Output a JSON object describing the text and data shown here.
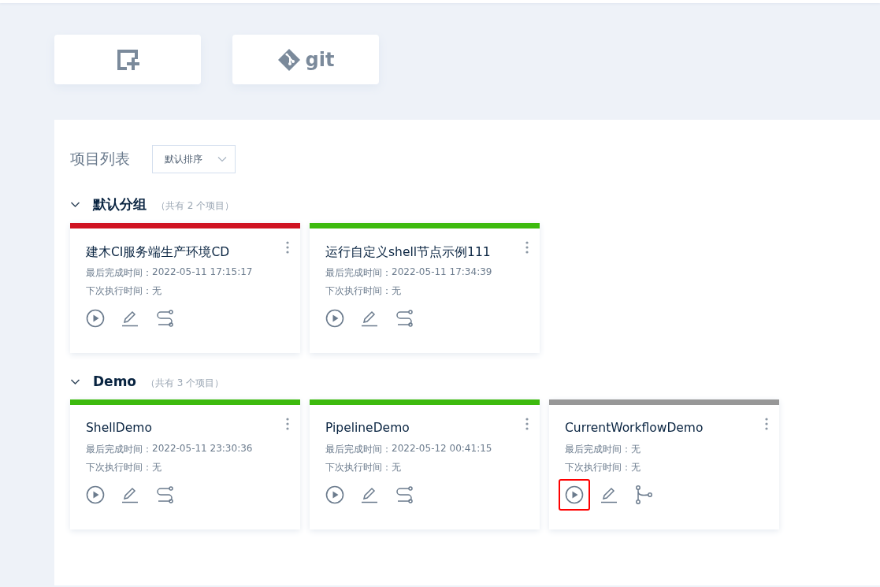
{
  "toolbar": {
    "git_label": "git"
  },
  "panel": {
    "title": "项目列表",
    "sort": {
      "value": "默认排序"
    }
  },
  "groups": [
    {
      "name": "默认分组",
      "count": "（共有 2 个项目）",
      "expanded": true,
      "cards": [
        {
          "kind": "pipeline",
          "color": "#cf1322",
          "title": "建木CI服务端生产环境CD",
          "last_label": "最后完成时间：",
          "last": "2022-05-11 17:15:17",
          "next_label": "下次执行时间：",
          "next": "无",
          "highlighted": false
        },
        {
          "kind": "pipeline",
          "color": "#3dba0e",
          "title": "运行自定义shell节点示例111",
          "last_label": "最后完成时间：",
          "last": "2022-05-11 17:34:39",
          "next_label": "下次执行时间：",
          "next": "无",
          "highlighted": false
        }
      ]
    },
    {
      "name": "Demo",
      "count": "（共有 3 个项目）",
      "expanded": true,
      "cards": [
        {
          "kind": "pipeline",
          "color": "#3dba0e",
          "title": "ShellDemo",
          "last_label": "最后完成时间：",
          "last": "2022-05-11 23:30:36",
          "next_label": "下次执行时间：",
          "next": "无",
          "highlighted": false
        },
        {
          "kind": "pipeline",
          "color": "#3dba0e",
          "title": "PipelineDemo",
          "last_label": "最后完成时间：",
          "last": "2022-05-12 00:41:15",
          "next_label": "下次执行时间：",
          "next": "无",
          "highlighted": false
        },
        {
          "kind": "workflow",
          "color": "#979797",
          "title": "CurrentWorkflowDemo",
          "last_label": "最后完成时间：",
          "last": "无",
          "next_label": "下次执行时间：",
          "next": "无",
          "highlighted": true
        }
      ]
    }
  ]
}
